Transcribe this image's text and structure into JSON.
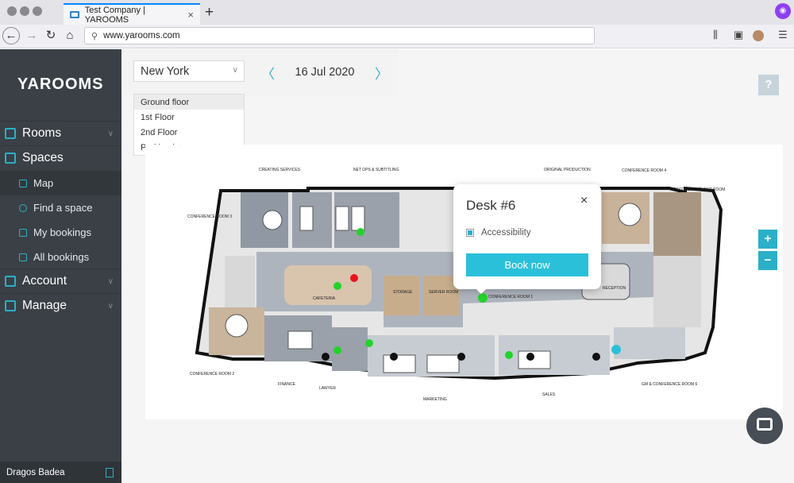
{
  "browser": {
    "tab_title": "Test Company | YAROOMS",
    "url": "www.yarooms.com",
    "new_tab": "+",
    "close_tab": "×"
  },
  "sidebar": {
    "logo": "YAROOMS",
    "sections": [
      {
        "label": "Rooms",
        "icon": "door-icon"
      },
      {
        "label": "Spaces",
        "icon": "grid-icon"
      },
      {
        "label": "Account",
        "icon": "account-icon"
      },
      {
        "label": "Manage",
        "icon": "manage-icon"
      }
    ],
    "spaces_items": [
      {
        "label": "Map",
        "icon": "map-icon"
      },
      {
        "label": "Find a space",
        "icon": "search-icon"
      },
      {
        "label": "My bookings",
        "icon": "bookings-icon"
      },
      {
        "label": "All bookings",
        "icon": "bookings-icon"
      }
    ],
    "user_name": "Dragos Badea"
  },
  "filters": {
    "city": "New York",
    "date": "16 Jul 2020",
    "floors": [
      "Ground floor",
      "1st Floor",
      "2nd Floor",
      "Parking lot"
    ],
    "selected_floor": "Ground floor"
  },
  "help_label": "?",
  "zoom": {
    "in": "+",
    "out": "−"
  },
  "popup": {
    "title": "Desk #6",
    "feature": "Accessibility",
    "book_label": "Book now",
    "close": "×"
  },
  "map_labels": {
    "creating_services": "CREATING SERVICES",
    "net_ops": "NET OPS & SUBTITLING",
    "original_production": "ORIGINAL PRODUCTION",
    "conference_room_4": "CONFERENCE ROOM 4",
    "recording": "RECORDING/EVENT ROOM",
    "conference_room_3": "CONFERENCE ROOM 3",
    "cafeteria": "CAFETERIA",
    "storage": "STORAGE",
    "server_room": "SERVER ROOM",
    "conference_room_1": "CONFERENCE ROOM 1",
    "reception": "RECEPTION",
    "conference_room_2": "CONFERENCE ROOM 2",
    "finance": "FINANCE",
    "lawyer": "LAWYER",
    "marketing": "MARKETING",
    "sales": "SALES",
    "gm_conference": "GM & CONFERENCE ROOM 6"
  },
  "colors": {
    "accent": "#2bb0c8",
    "sidebar_bg": "#3a4046",
    "available": "#22d32a",
    "booked": "#e8141c",
    "unavailable": "#111111"
  }
}
